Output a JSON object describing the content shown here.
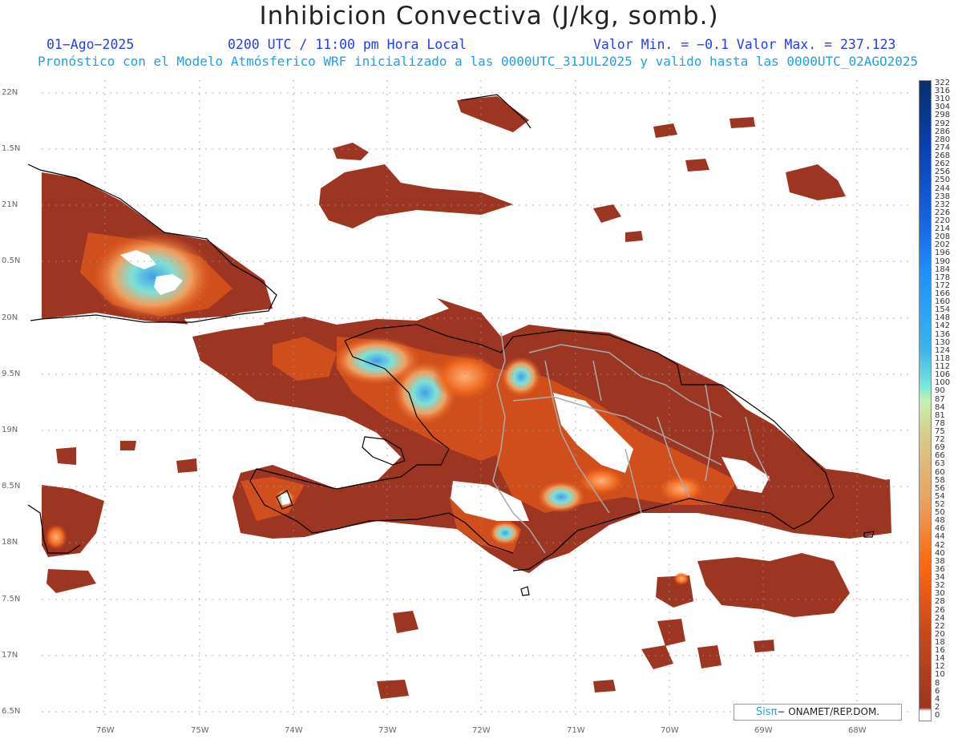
{
  "header": {
    "title": "Inhibicion Convectiva (J/kg, somb.)",
    "date": "01−Ago−2025",
    "time": "0200 UTC / 11:00 pm Hora Local",
    "min_max": "Valor Min. = −0.1  Valor Max. = 237.123",
    "forecast": "Pronóstico con el Modelo Atmósferico WRF inicializado a las 0000UTC_31JUL2025 y valido hasta las  0000UTC_02AGO2025"
  },
  "axes": {
    "lat_labels": [
      "22N",
      "1.5N",
      "21N",
      "0.5N",
      "20N",
      "9.5N",
      "19N",
      "8.5N",
      "18N",
      "7.5N",
      "17N",
      "6.5N"
    ],
    "lon_labels": [
      "76W",
      "75W",
      "74W",
      "73W",
      "72W",
      "71W",
      "70W",
      "69W",
      "68W"
    ]
  },
  "colorbar": {
    "labels": [
      "322",
      "316",
      "310",
      "304",
      "298",
      "292",
      "286",
      "280",
      "274",
      "268",
      "262",
      "256",
      "250",
      "244",
      "238",
      "232",
      "226",
      "220",
      "214",
      "208",
      "202",
      "196",
      "190",
      "184",
      "178",
      "172",
      "166",
      "160",
      "154",
      "148",
      "142",
      "136",
      "130",
      "124",
      "118",
      "112",
      "106",
      "100",
      "90",
      "87",
      "84",
      "81",
      "78",
      "75",
      "72",
      "69",
      "66",
      "63",
      "60",
      "58",
      "56",
      "54",
      "52",
      "50",
      "48",
      "46",
      "44",
      "42",
      "40",
      "38",
      "36",
      "34",
      "32",
      "30",
      "28",
      "26",
      "24",
      "22",
      "20",
      "18",
      "16",
      "14",
      "12",
      "10",
      "8",
      "6",
      "4",
      "2",
      "0"
    ],
    "high_color": "#08306b",
    "mid_color": "#1e90ff",
    "cyan_color": "#7fe8d8",
    "low_color": "#ff6a10",
    "base_color": "#9c3522"
  },
  "credit": {
    "brand": "Sisπ",
    "org": "− ONAMET/REP.DOM."
  }
}
